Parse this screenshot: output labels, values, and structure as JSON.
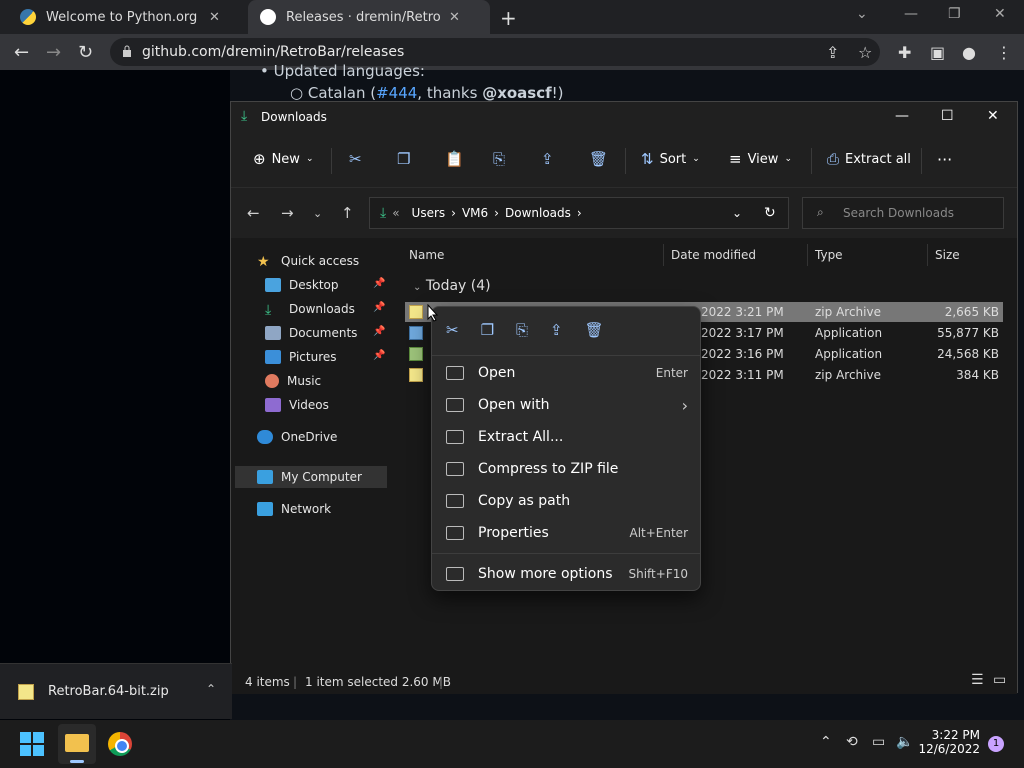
{
  "browser": {
    "tabs": [
      {
        "title": "Welcome to Python.org",
        "active": false
      },
      {
        "title": "Releases · dremin/RetroBar · GitH",
        "active": true
      }
    ],
    "new_tab": "+",
    "url": "github.com/dremin/RetroBar/releases"
  },
  "github_page": {
    "line1": "Updated languages:",
    "line2_prefix": "Catalan (",
    "line2_link": "#444",
    "line2_mid": ", thanks ",
    "line2_user": "@xoascf",
    "line2_suffix": "!)"
  },
  "explorer": {
    "title": "Downloads",
    "toolbar": {
      "new": "New",
      "sort": "Sort",
      "view": "View",
      "extract_all": "Extract all",
      "more": "···"
    },
    "path": [
      "Users",
      "VM6",
      "Downloads"
    ],
    "path_prefix": "«",
    "search_placeholder": "Search Downloads",
    "sidebar": {
      "quick_access": "Quick access",
      "items": [
        "Desktop",
        "Downloads",
        "Documents",
        "Pictures",
        "Music",
        "Videos"
      ],
      "onedrive": "OneDrive",
      "my_computer": "My Computer",
      "network": "Network"
    },
    "columns": [
      "Name",
      "Date modified",
      "Type",
      "Size"
    ],
    "group": "Today (4)",
    "rows": [
      {
        "date": "2022 3:21 PM",
        "type": "zip Archive",
        "size": "2,665 KB",
        "selected": true
      },
      {
        "date": "2022 3:17 PM",
        "type": "Application",
        "size": "55,877 KB",
        "selected": false
      },
      {
        "date": "2022 3:16 PM",
        "type": "Application",
        "size": "24,568 KB",
        "selected": false
      },
      {
        "date": "2022 3:11 PM",
        "type": "zip Archive",
        "size": "384 KB",
        "selected": false
      }
    ],
    "status": {
      "items": "4 items",
      "selected": "1 item selected  2.60 MB"
    }
  },
  "context_menu": {
    "items": [
      {
        "label": "Open",
        "shortcut": "Enter"
      },
      {
        "label": "Open with",
        "shortcut": "›"
      },
      {
        "label": "Extract All...",
        "shortcut": ""
      },
      {
        "label": "Compress to ZIP file",
        "shortcut": ""
      },
      {
        "label": "Copy as path",
        "shortcut": ""
      },
      {
        "label": "Properties",
        "shortcut": "Alt+Enter"
      },
      {
        "label": "Show more options",
        "shortcut": "Shift+F10"
      }
    ]
  },
  "download_shelf": {
    "file": "RetroBar.64-bit.zip"
  },
  "taskbar": {
    "time": "3:22 PM",
    "date": "12/6/2022",
    "notifications": "1"
  }
}
